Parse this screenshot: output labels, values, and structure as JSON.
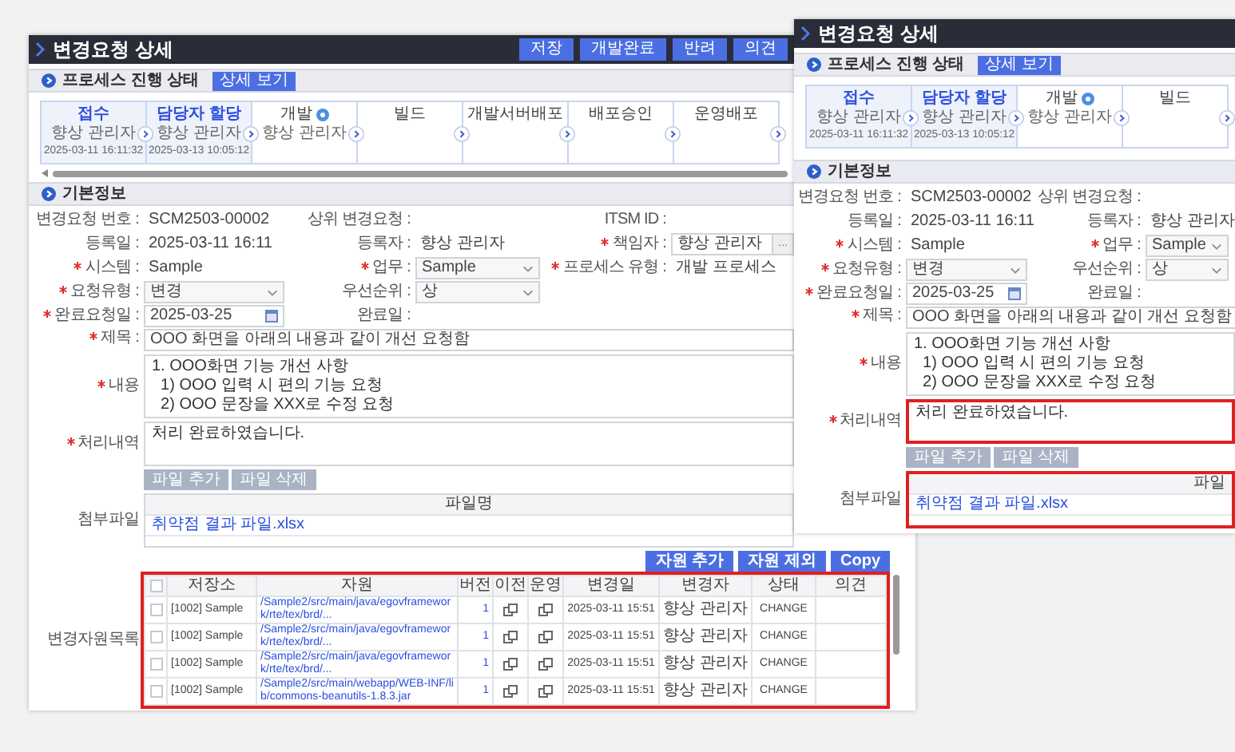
{
  "windows": [
    {
      "title": "변경요청 상세",
      "buttons": [
        "저장",
        "개발완료",
        "반려",
        "의견"
      ],
      "process": {
        "heading": "프로세스 진행 상태",
        "detail_button": "상세 보기",
        "steps": [
          {
            "name": "접수",
            "done": true,
            "info": false,
            "assignee": "향상 관리자",
            "time": "2025-03-11 16:11:32"
          },
          {
            "name": "담당자 할당",
            "done": true,
            "info": false,
            "assignee": "향상 관리자",
            "time": "2025-03-13 10:05:12"
          },
          {
            "name": "개발",
            "done": false,
            "info": true,
            "assignee": "향상 관리자"
          },
          {
            "name": "빌드",
            "done": false,
            "info": false
          },
          {
            "name": "개발서버배포",
            "done": false,
            "info": false
          },
          {
            "name": "배포승인",
            "done": false,
            "info": false
          },
          {
            "name": "운영배포",
            "done": false,
            "info": false
          }
        ]
      },
      "basic_info": {
        "heading": "기본정보",
        "rows": [
          [
            {
              "label": "변경요청 번호 :",
              "required": false,
              "kind": "text",
              "value": "SCM2503-00002"
            },
            {
              "label": "상위 변경요청 :",
              "required": false,
              "kind": "text"
            },
            {
              "label": "ITSM ID :",
              "required": false,
              "kind": "text"
            }
          ],
          [
            {
              "label": "등록일 :",
              "required": false,
              "kind": "text",
              "value": "2025-03-11 16:11"
            },
            {
              "label": "등록자 :",
              "required": false,
              "kind": "text",
              "value": "향상 관리자"
            },
            {
              "label": "책임자 :",
              "required": true,
              "kind": "lookup",
              "value": "향상 관리자",
              "button": "..."
            }
          ],
          [
            {
              "label": "시스템 :",
              "required": true,
              "kind": "text",
              "value": "Sample"
            },
            {
              "label": "업무 :",
              "required": true,
              "kind": "select",
              "value": "Sample"
            },
            {
              "label": "프로세스 유형 :",
              "required": true,
              "kind": "text",
              "value": "개발 프로세스"
            }
          ],
          [
            {
              "label": "요청유형 :",
              "required": true,
              "kind": "select",
              "value": "변경"
            },
            {
              "label": "우선순위 :",
              "required": false,
              "kind": "select",
              "value": "상"
            }
          ],
          [
            {
              "label": "완료요청일 :",
              "required": true,
              "kind": "date",
              "value": "2025-03-25"
            },
            {
              "label": "완료일 :",
              "required": false,
              "kind": "text"
            }
          ]
        ],
        "subject": {
          "label": "제목 :",
          "required": true,
          "value": "OOO 화면을 아래의 내용과 같이 개선 요청함"
        },
        "content": {
          "label": "내용",
          "required": true,
          "highlighted": false,
          "value": "1. OOO화면 기능 개선 사항\n  1) OOO 입력 시 편의 기능 요청\n  2) OOO 문장을 XXX로 수정 요청"
        },
        "result": {
          "label": "처리내역",
          "required": true,
          "highlighted": false,
          "value": "처리 완료하였습니다."
        },
        "attachments": {
          "label": "첨부파일",
          "highlighted": false,
          "buttons": [
            {
              "label": "파일 추가",
              "disabled": true
            },
            {
              "label": "파일 삭제",
              "disabled": true
            }
          ],
          "column": "파일명",
          "files": [
            "취약점 결과 파일.xlsx"
          ]
        }
      },
      "resources": {
        "label": "변경자원목록",
        "highlighted": true,
        "buttons": [
          "자원 추가",
          "자원 제외",
          "Copy"
        ],
        "all_checked": false,
        "columns": [
          "저장소",
          "자원",
          "버전",
          "이전",
          "운영",
          "변경일",
          "변경자",
          "상태",
          "의견"
        ],
        "rows": [
          {
            "checked": false,
            "repository": "[1002] Sample",
            "resource": "/Sample2/src/main/java/egovframework/rte/tex/brd/...",
            "version": "1",
            "changed": "2025-03-11 15:51",
            "changer": "향상 관리자",
            "status": "CHANGE"
          },
          {
            "checked": false,
            "repository": "[1002] Sample",
            "resource": "/Sample2/src/main/java/egovframework/rte/tex/brd/...",
            "version": "1",
            "changed": "2025-03-11 15:51",
            "changer": "향상 관리자",
            "status": "CHANGE"
          },
          {
            "checked": false,
            "repository": "[1002] Sample",
            "resource": "/Sample2/src/main/java/egovframework/rte/tex/brd/...",
            "version": "1",
            "changed": "2025-03-11 15:51",
            "changer": "향상 관리자",
            "status": "CHANGE"
          },
          {
            "checked": false,
            "repository": "[1002] Sample",
            "resource": "/Sample2/src/main/webapp/WEB-INF/lib/commons-beanutils-1.8.3.jar",
            "version": "1",
            "changed": "2025-03-11 15:51",
            "changer": "향상 관리자",
            "status": "CHANGE"
          }
        ]
      }
    },
    {
      "title": "변경요청 상세",
      "process": {
        "heading": "프로세스 진행 상태",
        "detail_button": "상세 보기",
        "steps": [
          {
            "name": "접수",
            "done": true,
            "info": false,
            "assignee": "향상 관리자",
            "time": "2025-03-11 16:11:32"
          },
          {
            "name": "담당자 할당",
            "done": true,
            "info": false,
            "assignee": "향상 관리자",
            "time": "2025-03-13 10:05:12"
          },
          {
            "name": "개발",
            "done": false,
            "info": true,
            "assignee": "향상 관리자"
          },
          {
            "name": "빌드",
            "done": false,
            "info": false
          }
        ]
      },
      "basic_info": {
        "heading": "기본정보",
        "rows": [
          [
            {
              "label": "변경요청 번호 :",
              "required": false,
              "kind": "text",
              "value": "SCM2503-00002"
            },
            {
              "label": "상위 변경요청 :",
              "required": false,
              "kind": "text"
            }
          ],
          [
            {
              "label": "등록일 :",
              "required": false,
              "kind": "text",
              "value": "2025-03-11 16:11"
            },
            {
              "label": "등록자 :",
              "required": false,
              "kind": "text",
              "value": "향상 관리자"
            }
          ],
          [
            {
              "label": "시스템 :",
              "required": true,
              "kind": "text",
              "value": "Sample"
            },
            {
              "label": "업무 :",
              "required": true,
              "kind": "select",
              "value": "Sample"
            }
          ],
          [
            {
              "label": "요청유형 :",
              "required": true,
              "kind": "select",
              "value": "변경"
            },
            {
              "label": "우선순위 :",
              "required": false,
              "kind": "select",
              "value": "상"
            }
          ],
          [
            {
              "label": "완료요청일 :",
              "required": true,
              "kind": "date",
              "value": "2025-03-25"
            },
            {
              "label": "완료일 :",
              "required": false,
              "kind": "text"
            }
          ]
        ],
        "subject": {
          "label": "제목 :",
          "required": true,
          "value": "OOO 화면을 아래의 내용과 같이 개선 요청함"
        },
        "content": {
          "label": "내용",
          "required": true,
          "highlighted": false,
          "value": "1. OOO화면 기능 개선 사항\n  1) OOO 입력 시 편의 기능 요청\n  2) OOO 문장을 XXX로 수정 요청"
        },
        "result": {
          "label": "처리내역",
          "required": true,
          "highlighted": true,
          "value": "처리 완료하였습니다."
        },
        "attachments": {
          "label": "첨부파일",
          "highlighted": true,
          "buttons": [
            {
              "label": "파일 추가",
              "disabled": true
            },
            {
              "label": "파일 삭제",
              "disabled": true
            }
          ],
          "column": "파일",
          "files": [
            "취약점 결과 파일.xlsx"
          ]
        }
      }
    }
  ]
}
